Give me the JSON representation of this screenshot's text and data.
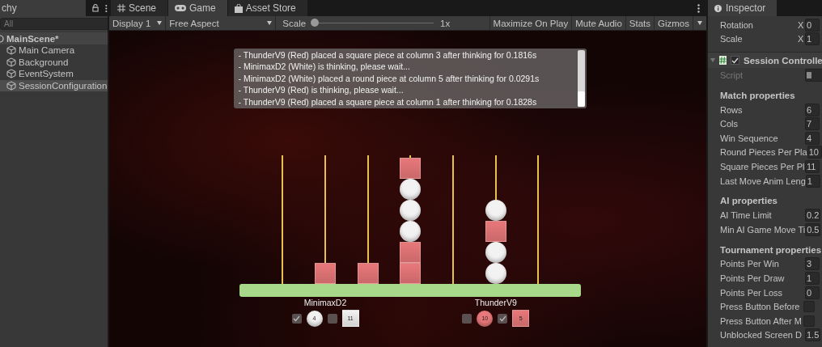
{
  "hierarchy": {
    "tab": "chy",
    "search": {
      "placeholder": "All"
    },
    "scene": {
      "label": "MainScene*",
      "expanded": true,
      "children": [
        {
          "label": "Main Camera",
          "selected": false
        },
        {
          "label": "Background",
          "selected": false
        },
        {
          "label": "EventSystem",
          "selected": false
        },
        {
          "label": "SessionConfiguration",
          "selected": true
        }
      ]
    }
  },
  "game": {
    "tabs": [
      {
        "label": "Scene",
        "kind": "scene",
        "selected": false
      },
      {
        "label": "Game",
        "kind": "game",
        "selected": true
      },
      {
        "label": "Asset Store",
        "kind": "store",
        "selected": false
      }
    ],
    "toolbar": {
      "display": "Display 1",
      "aspect": "Free Aspect",
      "scale_label": "Scale",
      "scale": {
        "level": 0.0
      },
      "scale_value": "1x",
      "buttons": [
        "Maximize On Play",
        "Mute Audio",
        "Stats",
        "Gizmos"
      ]
    },
    "log": [
      "- ThunderV9 (Red) placed a square piece at column 3 after thinking for 0.1816s",
      "- MinimaxD2 (White) is thinking, please wait...",
      "- MinimaxD2 (White) placed a round piece at column 5 after thinking for 0.0291s",
      "- ThunderV9 (Red) is thinking, please wait...",
      "- ThunderV9 (Red) placed a square piece at column 1 after thinking for 0.1828s"
    ],
    "board": {
      "columns": [
        {},
        {
          "pieces": [
            {
              "kind": "square",
              "color": "#e8787a"
            }
          ]
        },
        {
          "pieces": [
            {
              "kind": "square",
              "color": "#e8787a"
            }
          ]
        },
        {
          "pieces": [
            {
              "kind": "square",
              "color": "#e8787a"
            },
            {
              "kind": "square",
              "color": "#e8787a"
            },
            {
              "kind": "round",
              "color": "#f2f2f2"
            },
            {
              "kind": "round",
              "color": "#f2f2f2"
            },
            {
              "kind": "round",
              "color": "#f2f2f2"
            },
            {
              "kind": "square",
              "color": "#e8787a"
            }
          ]
        },
        {},
        {
          "pieces": [
            {
              "kind": "round",
              "color": "#f2f2f2"
            },
            {
              "kind": "round",
              "color": "#f2f2f2"
            },
            {
              "kind": "square",
              "color": "#e8787a"
            },
            {
              "kind": "round",
              "color": "#f2f2f2"
            }
          ]
        },
        {}
      ]
    },
    "players": [
      {
        "name": "MinimaxD2",
        "color": "#f2f2f2",
        "round": {
          "count": "4",
          "checked": true
        },
        "square": {
          "count": "11",
          "checked": false
        }
      },
      {
        "name": "ThunderV9",
        "color": "#e8787a",
        "round": {
          "count": "10",
          "checked": false
        },
        "square": {
          "count": "5",
          "checked": true
        }
      }
    ]
  },
  "inspector": {
    "tab": "Inspector",
    "transform": [
      {
        "label": "Rotation",
        "axis": "X",
        "value": "0"
      },
      {
        "label": "Scale",
        "axis": "X",
        "value": "1"
      }
    ],
    "component": {
      "title": "Session Controlle",
      "enabled": true,
      "expanded": true,
      "script_label": "Script"
    },
    "sections": [
      {
        "title": "Match properties",
        "fields": [
          {
            "kind": "number",
            "label": "Rows",
            "value": "6"
          },
          {
            "kind": "number",
            "label": "Cols",
            "value": "7"
          },
          {
            "kind": "number",
            "label": "Win Sequence",
            "value": "4"
          },
          {
            "kind": "number",
            "label": "Round Pieces Per Pla",
            "value": "10"
          },
          {
            "kind": "number",
            "label": "Square Pieces Per Pl",
            "value": "11"
          },
          {
            "kind": "number",
            "label": "Last Move Anim Leng",
            "value": "1"
          }
        ]
      },
      {
        "title": "AI properties",
        "fields": [
          {
            "kind": "number",
            "label": "AI Time Limit",
            "value": "0.2"
          },
          {
            "kind": "number",
            "label": "Min AI Game Move Ti",
            "value": "0.5"
          }
        ]
      },
      {
        "title": "Tournament properties",
        "fields": [
          {
            "kind": "number",
            "label": "Points Per Win",
            "value": "3"
          },
          {
            "kind": "number",
            "label": "Points Per Draw",
            "value": "1"
          },
          {
            "kind": "number",
            "label": "Points Per Loss",
            "value": "0"
          },
          {
            "kind": "checkbox",
            "label": "Press Button Before",
            "checked": false
          },
          {
            "kind": "checkbox",
            "label": "Press Button After M",
            "checked": false
          },
          {
            "kind": "number",
            "label": "Unblocked Screen D",
            "value": "1.5"
          }
        ]
      }
    ]
  }
}
